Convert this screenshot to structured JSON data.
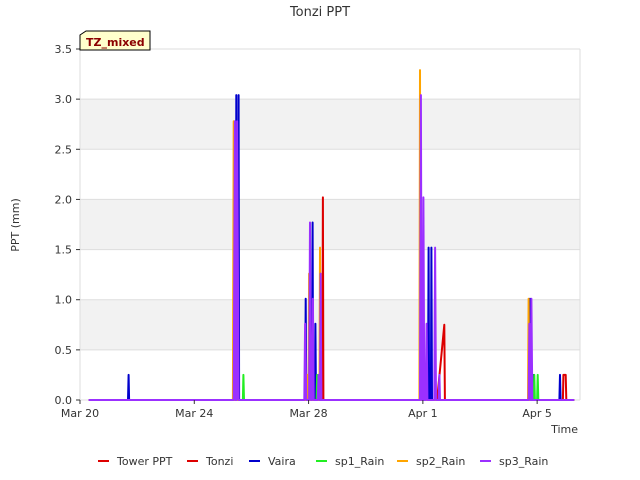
{
  "chart_data": {
    "type": "line",
    "title": "Tonzi PPT",
    "xlabel": "Time",
    "ylabel": "PPT (mm)",
    "badge": "TZ_mixed",
    "xlim": [
      0,
      17.5
    ],
    "ylim": [
      0,
      3.5
    ],
    "grid": true,
    "legend_position": "bottom",
    "x_ticks": [
      {
        "x": 0,
        "label": "Mar 20"
      },
      {
        "x": 4,
        "label": "Mar 24"
      },
      {
        "x": 8,
        "label": "Mar 28"
      },
      {
        "x": 12,
        "label": "Apr 1"
      },
      {
        "x": 16,
        "label": "Apr 5"
      }
    ],
    "y_ticks": [
      0.0,
      0.5,
      1.0,
      1.5,
      2.0,
      2.5,
      3.0,
      3.5
    ],
    "y_tick_labels": [
      "0.0",
      "0.5",
      "1.0",
      "1.5",
      "2.0",
      "2.5",
      "3.0",
      "3.5"
    ],
    "series": [
      {
        "name": "Tower PPT",
        "color": "#dd0000",
        "points": [
          [
            0.3,
            0
          ],
          [
            17.3,
            0
          ]
        ]
      },
      {
        "name": "Tonzi",
        "color": "#dd0000",
        "points": [
          [
            0.3,
            0
          ],
          [
            8.48,
            0
          ],
          [
            8.5,
            2.02
          ],
          [
            8.52,
            0
          ],
          [
            12.5,
            0
          ],
          [
            12.75,
            0.75
          ],
          [
            12.77,
            0
          ],
          [
            16.9,
            0
          ],
          [
            16.92,
            0.25
          ],
          [
            17.0,
            0.25
          ],
          [
            17.02,
            0
          ],
          [
            17.3,
            0
          ]
        ]
      },
      {
        "name": "Vaira",
        "color": "#0000cc",
        "points": [
          [
            0.3,
            0
          ],
          [
            1.68,
            0
          ],
          [
            1.7,
            0.25
          ],
          [
            1.72,
            0
          ],
          [
            5.45,
            0
          ],
          [
            5.47,
            3.04
          ],
          [
            5.49,
            0
          ],
          [
            5.53,
            0
          ],
          [
            5.55,
            3.04
          ],
          [
            5.57,
            0
          ],
          [
            7.88,
            0
          ],
          [
            7.9,
            1.01
          ],
          [
            7.92,
            0
          ],
          [
            8.12,
            0
          ],
          [
            8.14,
            1.77
          ],
          [
            8.16,
            0
          ],
          [
            8.22,
            0
          ],
          [
            8.24,
            0.76
          ],
          [
            8.26,
            0
          ],
          [
            12.18,
            0
          ],
          [
            12.2,
            1.52
          ],
          [
            12.22,
            0
          ],
          [
            12.28,
            0
          ],
          [
            12.3,
            1.52
          ],
          [
            12.32,
            0
          ],
          [
            15.73,
            0
          ],
          [
            15.75,
            1.01
          ],
          [
            15.77,
            0
          ],
          [
            15.83,
            0
          ],
          [
            15.85,
            0.25
          ],
          [
            15.87,
            0
          ],
          [
            16.78,
            0
          ],
          [
            16.8,
            0.25
          ],
          [
            16.82,
            0
          ],
          [
            17.3,
            0
          ]
        ]
      },
      {
        "name": "sp1_Rain",
        "color": "#22ee22",
        "points": [
          [
            0.3,
            0
          ],
          [
            5.7,
            0
          ],
          [
            5.72,
            0.25
          ],
          [
            5.74,
            0
          ],
          [
            7.93,
            0
          ],
          [
            7.95,
            0.25
          ],
          [
            7.97,
            0
          ],
          [
            8.28,
            0
          ],
          [
            8.3,
            0.25
          ],
          [
            8.32,
            0
          ],
          [
            15.88,
            0
          ],
          [
            15.9,
            0.25
          ],
          [
            15.92,
            0
          ],
          [
            16.0,
            0
          ],
          [
            16.02,
            0.25
          ],
          [
            16.04,
            0
          ],
          [
            17.3,
            0
          ]
        ]
      },
      {
        "name": "sp2_Rain",
        "color": "#ffa500",
        "points": [
          [
            0.3,
            0
          ],
          [
            5.35,
            0
          ],
          [
            5.38,
            2.78
          ],
          [
            5.4,
            0
          ],
          [
            7.93,
            0
          ],
          [
            7.95,
            0.25
          ],
          [
            7.97,
            0
          ],
          [
            8.0,
            0
          ],
          [
            8.02,
            1.26
          ],
          [
            8.04,
            0
          ],
          [
            8.38,
            0
          ],
          [
            8.4,
            1.52
          ],
          [
            8.42,
            0
          ],
          [
            11.88,
            0
          ],
          [
            11.9,
            3.29
          ],
          [
            11.92,
            0
          ],
          [
            11.98,
            0
          ],
          [
            12.0,
            1.01
          ],
          [
            12.02,
            0
          ],
          [
            15.68,
            0
          ],
          [
            15.7,
            1.01
          ],
          [
            15.72,
            0
          ],
          [
            17.3,
            0
          ]
        ]
      },
      {
        "name": "sp3_Rain",
        "color": "#9b30ff",
        "points": [
          [
            0.3,
            0
          ],
          [
            5.38,
            0
          ],
          [
            5.42,
            2.78
          ],
          [
            5.44,
            0
          ],
          [
            5.48,
            0
          ],
          [
            5.5,
            2.78
          ],
          [
            5.55,
            0
          ],
          [
            7.85,
            0
          ],
          [
            7.88,
            0.76
          ],
          [
            7.92,
            0
          ],
          [
            8.02,
            0
          ],
          [
            8.05,
            1.77
          ],
          [
            8.08,
            0
          ],
          [
            8.12,
            0
          ],
          [
            8.15,
            1.01
          ],
          [
            8.18,
            0
          ],
          [
            8.32,
            0
          ],
          [
            8.35,
            0.25
          ],
          [
            8.38,
            0
          ],
          [
            8.4,
            0
          ],
          [
            8.42,
            1.26
          ],
          [
            8.45,
            0
          ],
          [
            11.9,
            0
          ],
          [
            11.93,
            3.04
          ],
          [
            11.96,
            0
          ],
          [
            12.0,
            0
          ],
          [
            12.02,
            2.02
          ],
          [
            12.05,
            0
          ],
          [
            12.1,
            0
          ],
          [
            12.13,
            0.76
          ],
          [
            12.16,
            0
          ],
          [
            12.4,
            0
          ],
          [
            12.43,
            1.52
          ],
          [
            12.46,
            0
          ],
          [
            12.55,
            0
          ],
          [
            12.58,
            0.25
          ],
          [
            12.6,
            0
          ],
          [
            15.7,
            0
          ],
          [
            15.73,
            0.76
          ],
          [
            15.76,
            0
          ],
          [
            15.78,
            0
          ],
          [
            15.8,
            1.01
          ],
          [
            15.83,
            0
          ],
          [
            17.3,
            0
          ]
        ]
      }
    ]
  }
}
